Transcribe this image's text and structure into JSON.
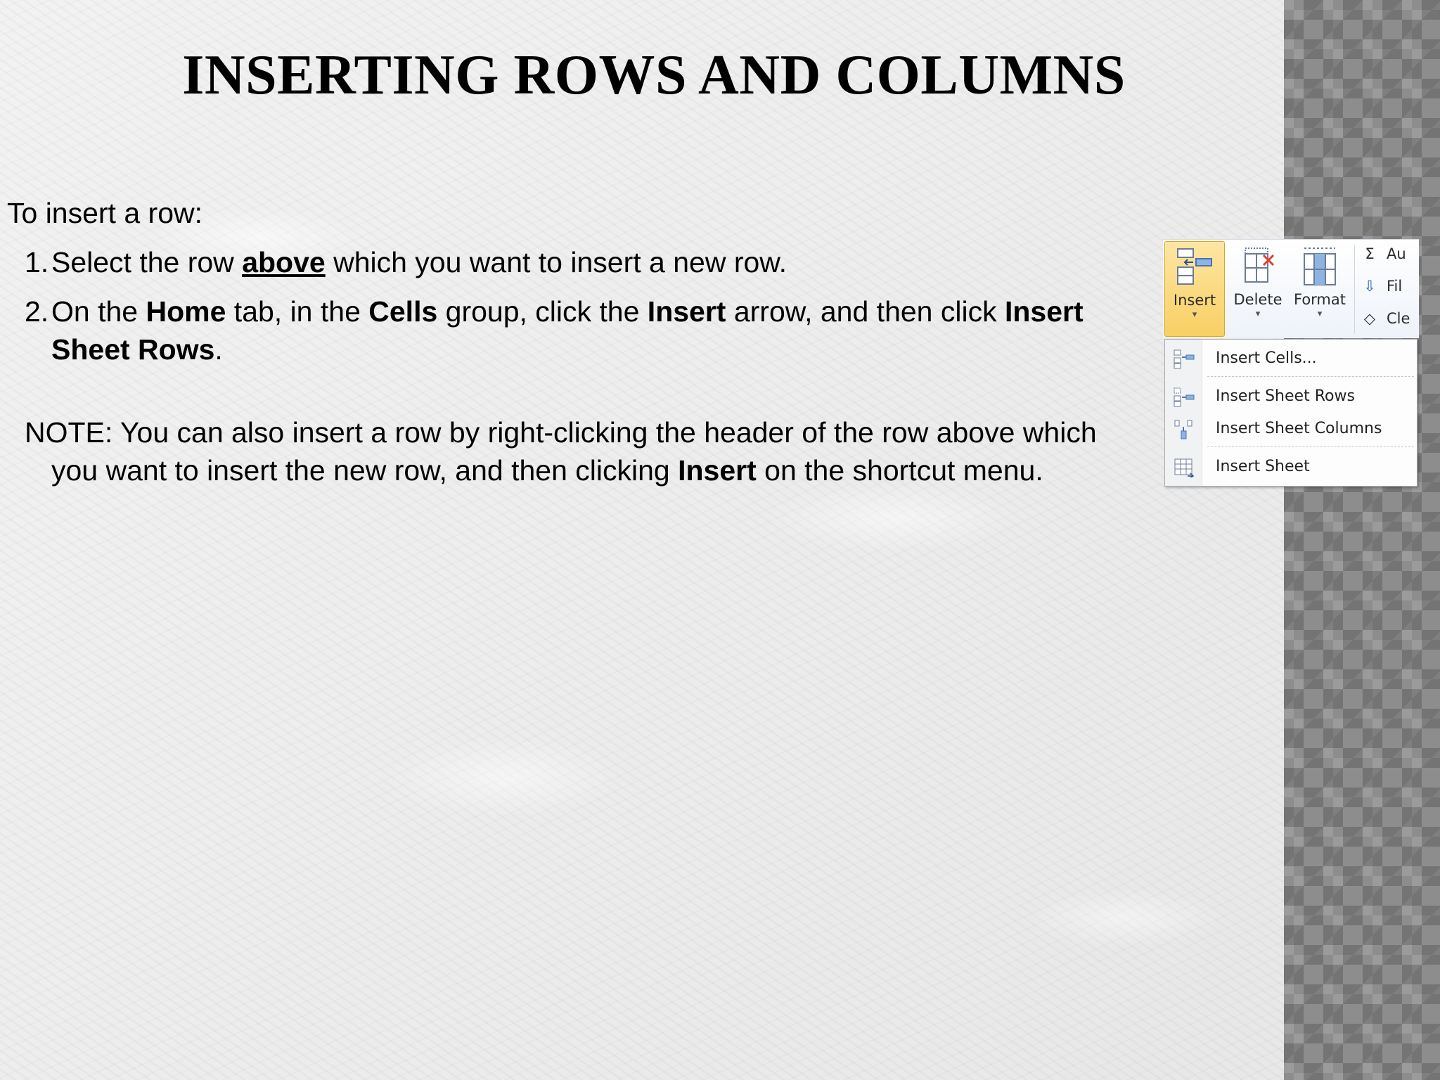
{
  "slide": {
    "title": "INSERTING ROWS AND COLUMNS",
    "intro": "To insert a row:",
    "steps": [
      {
        "num": "1.",
        "parts": [
          "Select the row ",
          "above",
          " which you want to insert a new row."
        ]
      },
      {
        "num": "2.",
        "parts": [
          "On the ",
          "Home",
          " tab, in the ",
          "Cells",
          " group, click the ",
          "Insert",
          " arrow, and then click ",
          "Insert Sheet Rows",
          "."
        ]
      }
    ],
    "note": {
      "parts": [
        "NOTE: You can also insert a row by right-clicking the header of the row above which you want to insert the new row, and then clicking ",
        "Insert",
        " on the shortcut menu."
      ]
    }
  },
  "ribbon": {
    "insert_label": "Insert",
    "delete_label": "Delete",
    "format_label": "Format",
    "dropdown_arrow": "▾",
    "side_items": [
      {
        "glyph": "Σ",
        "label": "Au"
      },
      {
        "glyph": "⇩",
        "label": "Fil"
      },
      {
        "glyph": "◇",
        "label": "Cle"
      }
    ],
    "menu_items": [
      {
        "label": "Insert Cells...",
        "icon": "insert-cells-icon"
      },
      {
        "label": "Insert Sheet Rows",
        "icon": "insert-rows-icon"
      },
      {
        "label": "Insert Sheet Columns",
        "icon": "insert-columns-icon"
      },
      {
        "label": "Insert Sheet",
        "icon": "insert-sheet-icon"
      }
    ]
  },
  "colors": {
    "insert_highlight": "#f8cf62",
    "delete_x": "#e0402a",
    "side_band": "#8d8d8d"
  }
}
